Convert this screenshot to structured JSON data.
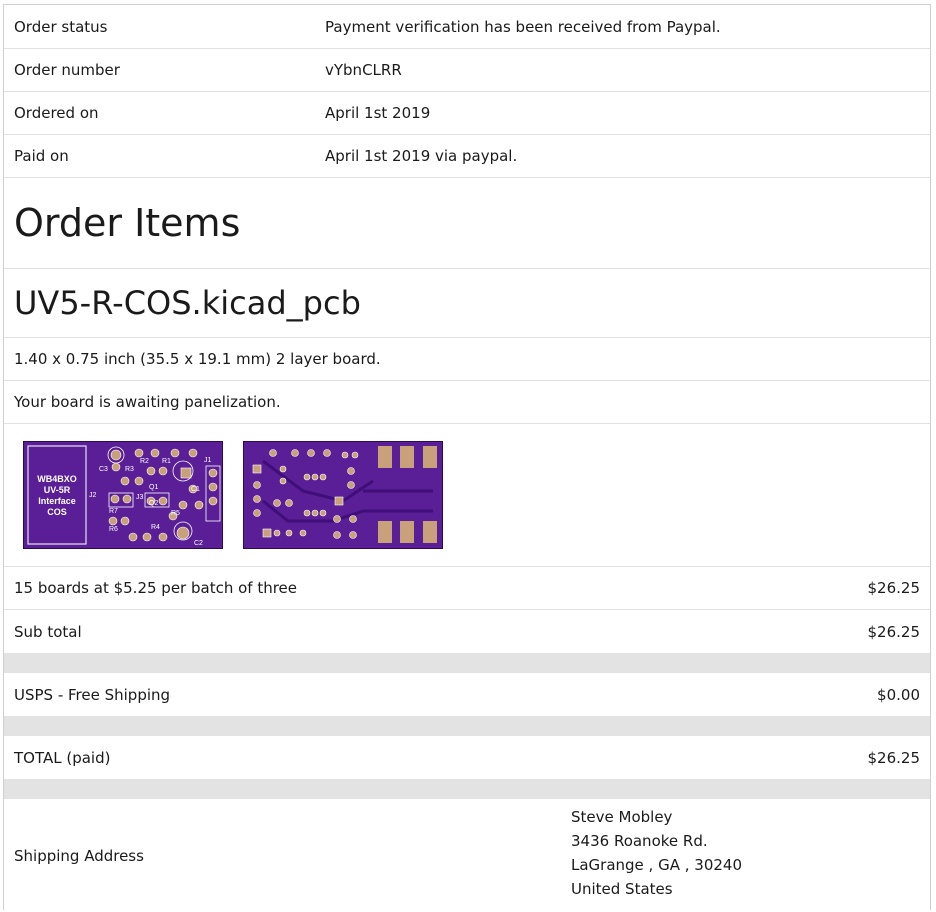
{
  "order": {
    "status_label": "Order status",
    "status_value": "Payment verification has been received from Paypal.",
    "number_label": "Order number",
    "number_value": "vYbnCLRR",
    "ordered_label": "Ordered on",
    "ordered_value": "April 1st 2019",
    "paid_label": "Paid on",
    "paid_value": "April 1st 2019 via paypal."
  },
  "items": {
    "heading": "Order Items",
    "file_name": "UV5-R-COS.kicad_pcb",
    "dimensions": "1.40 x 0.75 inch (35.5 x 19.1 mm) 2 layer board.",
    "status": "Your board is awaiting panelization.",
    "board_label_lines": [
      "WB4BXO",
      "UV-5R",
      "Interface",
      "COS"
    ],
    "silk_labels": [
      "C3",
      "R3",
      "R2",
      "R1",
      "J1",
      "Q1",
      "C1",
      "J2",
      "J3",
      "R7",
      "Q2",
      "R5",
      "R6",
      "R4",
      "C2"
    ]
  },
  "pricing": {
    "line_label": "15 boards at $5.25 per batch of three",
    "line_amount": "$26.25",
    "subtotal_label": "Sub total",
    "subtotal_amount": "$26.25",
    "shipping_label": "USPS - Free Shipping",
    "shipping_amount": "$0.00",
    "total_label": "TOTAL (paid)",
    "total_amount": "$26.25"
  },
  "shipping": {
    "label": "Shipping Address",
    "name": "Steve Mobley",
    "street": "3436 Roanoke Rd.",
    "city_line": "LaGrange , GA , 30240",
    "country": "United States"
  },
  "colors": {
    "pcb_purple": "#5a1e96",
    "pad_gold": "#c8a07a",
    "gap_gray": "#e3e3e3"
  }
}
